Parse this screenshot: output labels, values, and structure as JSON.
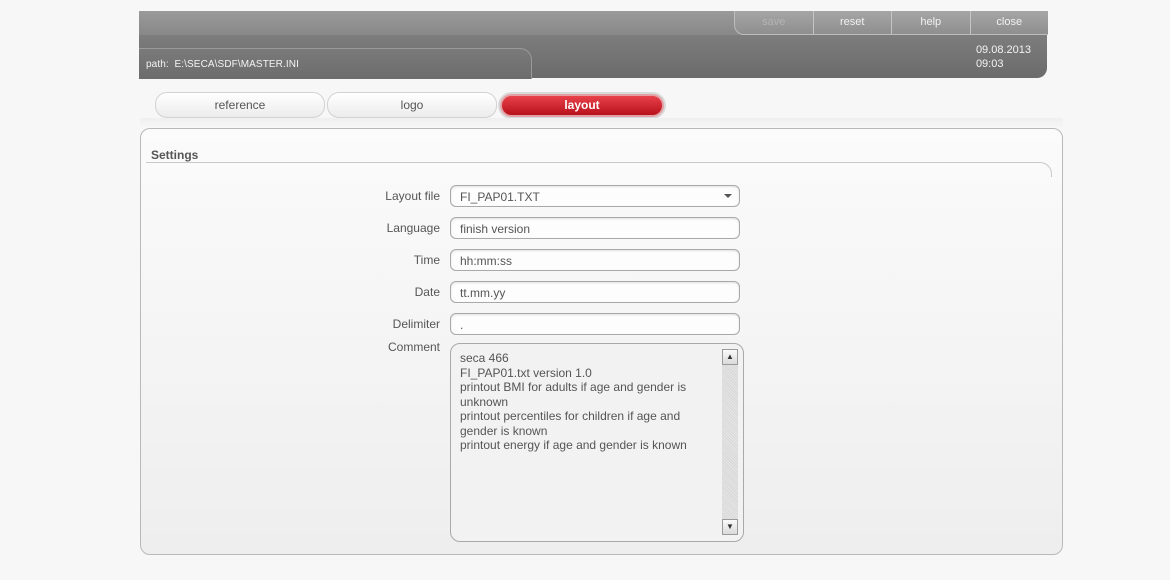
{
  "header": {
    "path_label": "path:",
    "path_value": "E:\\SECA\\SDF\\MASTER.INI",
    "buttons": [
      {
        "label": "save",
        "enabled": false
      },
      {
        "label": "reset",
        "enabled": true
      },
      {
        "label": "help",
        "enabled": true
      },
      {
        "label": "close",
        "enabled": true
      }
    ],
    "date": "09.08.2013",
    "time": "09:03"
  },
  "tabs": [
    {
      "label": "reference",
      "active": false
    },
    {
      "label": "logo",
      "active": false
    },
    {
      "label": "layout",
      "active": true
    }
  ],
  "settings": {
    "title": "Settings",
    "fields": {
      "layout_file": {
        "label": "Layout file",
        "value": "FI_PAP01.TXT"
      },
      "language": {
        "label": "Language",
        "value": "finish version"
      },
      "time": {
        "label": "Time",
        "value": "hh:mm:ss"
      },
      "date": {
        "label": "Date",
        "value": "tt.mm.yy"
      },
      "delimiter": {
        "label": "Delimiter",
        "value": "."
      },
      "comment": {
        "label": "Comment",
        "lines": [
          "seca 466",
          "FI_PAP01.txt version 1.0",
          "printout  BMI for adults if age and gender is unknown",
          "printout  percentiles for children if age and gender is known",
          "printout  energy if age and gender is known"
        ]
      }
    }
  },
  "colors": {
    "header_gray": "#7a7a7a",
    "active_tab_red": "#c8101c",
    "panel_border": "#b9b9b9"
  }
}
